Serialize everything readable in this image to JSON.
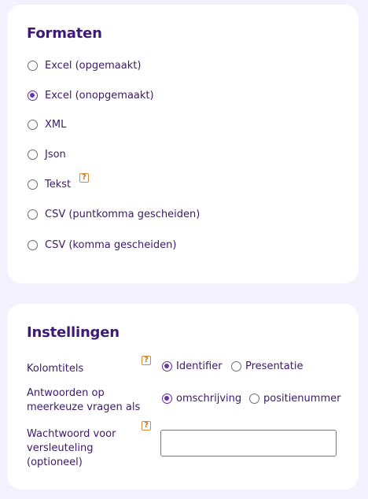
{
  "formats": {
    "title": "Formaten",
    "options": [
      {
        "label": "Excel (opgemaakt)",
        "checked": false
      },
      {
        "label": "Excel (onopgemaakt)",
        "checked": true
      },
      {
        "label": "XML",
        "checked": false
      },
      {
        "label": "Json",
        "checked": false
      },
      {
        "label": "Tekst",
        "checked": false,
        "help": "?"
      },
      {
        "label": "CSV (puntkomma gescheiden)",
        "checked": false
      },
      {
        "label": "CSV (komma gescheiden)",
        "checked": false
      }
    ]
  },
  "settings": {
    "title": "Instellingen",
    "column_titles": {
      "label": "Kolomtitels",
      "help": "?",
      "options": [
        {
          "label": "Identifier",
          "checked": true
        },
        {
          "label": "Presentatie",
          "checked": false
        }
      ]
    },
    "multiple_choice": {
      "label": "Antwoorden op meerkeuze vragen als",
      "options": [
        {
          "label": "omschrijving",
          "checked": true
        },
        {
          "label": "positienummer",
          "checked": false
        }
      ]
    },
    "password": {
      "label": "Wachtwoord voor versleuteling (optioneel)",
      "help": "?",
      "value": "",
      "placeholder": ""
    }
  },
  "colors": {
    "background": "#f3f1fd",
    "card": "#ffffff",
    "heading": "#3e1a72",
    "radio_checked": "#6a36b0",
    "help_border": "#d08a3a"
  }
}
